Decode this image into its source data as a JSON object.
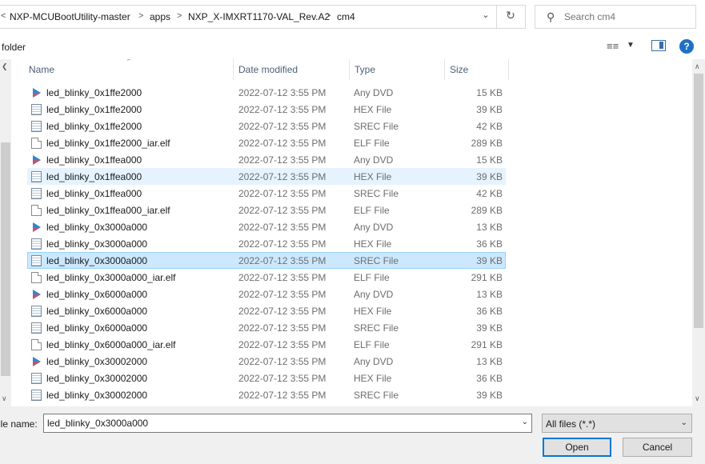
{
  "address_bar": {
    "breadcrumbs": [
      "NXP-MCUBootUtility-master",
      "apps",
      "NXP_X-IMXRT1170-VAL_Rev.A2",
      "cm4"
    ],
    "leading_chevron": "<",
    "separator_glyph": ">",
    "dropdown_icon": "chevron-down-icon",
    "refresh_icon": "refresh-icon"
  },
  "search": {
    "placeholder": "Search cm4",
    "icon": "search-icon"
  },
  "toolbar": {
    "new_folder_label": "folder",
    "views_icon": "view-options-icon",
    "preview_pane_icon": "preview-pane-icon",
    "help_label": "?"
  },
  "columns": {
    "name": "Name",
    "date": "Date modified",
    "type": "Type",
    "size": "Size"
  },
  "files": [
    {
      "name": "led_blinky_0x1ffe2000",
      "date": "2022-07-12 3:55 PM",
      "type": "Any DVD",
      "size": "15 KB",
      "icon": "dvd-file-icon",
      "state": "normal"
    },
    {
      "name": "led_blinky_0x1ffe2000",
      "date": "2022-07-12 3:55 PM",
      "type": "HEX File",
      "size": "39 KB",
      "icon": "text-file-icon",
      "state": "normal"
    },
    {
      "name": "led_blinky_0x1ffe2000",
      "date": "2022-07-12 3:55 PM",
      "type": "SREC File",
      "size": "42 KB",
      "icon": "text-file-icon",
      "state": "normal"
    },
    {
      "name": "led_blinky_0x1ffe2000_iar.elf",
      "date": "2022-07-12 3:55 PM",
      "type": "ELF File",
      "size": "289 KB",
      "icon": "blank-file-icon",
      "state": "normal"
    },
    {
      "name": "led_blinky_0x1ffea000",
      "date": "2022-07-12 3:55 PM",
      "type": "Any DVD",
      "size": "15 KB",
      "icon": "dvd-file-icon",
      "state": "normal"
    },
    {
      "name": "led_blinky_0x1ffea000",
      "date": "2022-07-12 3:55 PM",
      "type": "HEX File",
      "size": "39 KB",
      "icon": "text-file-icon",
      "state": "hover"
    },
    {
      "name": "led_blinky_0x1ffea000",
      "date": "2022-07-12 3:55 PM",
      "type": "SREC File",
      "size": "42 KB",
      "icon": "text-file-icon",
      "state": "normal"
    },
    {
      "name": "led_blinky_0x1ffea000_iar.elf",
      "date": "2022-07-12 3:55 PM",
      "type": "ELF File",
      "size": "289 KB",
      "icon": "blank-file-icon",
      "state": "normal"
    },
    {
      "name": "led_blinky_0x3000a000",
      "date": "2022-07-12 3:55 PM",
      "type": "Any DVD",
      "size": "13 KB",
      "icon": "dvd-file-icon",
      "state": "normal"
    },
    {
      "name": "led_blinky_0x3000a000",
      "date": "2022-07-12 3:55 PM",
      "type": "HEX File",
      "size": "36 KB",
      "icon": "text-file-icon",
      "state": "normal"
    },
    {
      "name": "led_blinky_0x3000a000",
      "date": "2022-07-12 3:55 PM",
      "type": "SREC File",
      "size": "39 KB",
      "icon": "text-file-icon",
      "state": "selected"
    },
    {
      "name": "led_blinky_0x3000a000_iar.elf",
      "date": "2022-07-12 3:55 PM",
      "type": "ELF File",
      "size": "291 KB",
      "icon": "blank-file-icon",
      "state": "normal"
    },
    {
      "name": "led_blinky_0x6000a000",
      "date": "2022-07-12 3:55 PM",
      "type": "Any DVD",
      "size": "13 KB",
      "icon": "dvd-file-icon",
      "state": "normal"
    },
    {
      "name": "led_blinky_0x6000a000",
      "date": "2022-07-12 3:55 PM",
      "type": "HEX File",
      "size": "36 KB",
      "icon": "text-file-icon",
      "state": "normal"
    },
    {
      "name": "led_blinky_0x6000a000",
      "date": "2022-07-12 3:55 PM",
      "type": "SREC File",
      "size": "39 KB",
      "icon": "text-file-icon",
      "state": "normal"
    },
    {
      "name": "led_blinky_0x6000a000_iar.elf",
      "date": "2022-07-12 3:55 PM",
      "type": "ELF File",
      "size": "291 KB",
      "icon": "blank-file-icon",
      "state": "normal"
    },
    {
      "name": "led_blinky_0x30002000",
      "date": "2022-07-12 3:55 PM",
      "type": "Any DVD",
      "size": "13 KB",
      "icon": "dvd-file-icon",
      "state": "normal"
    },
    {
      "name": "led_blinky_0x30002000",
      "date": "2022-07-12 3:55 PM",
      "type": "HEX File",
      "size": "36 KB",
      "icon": "text-file-icon",
      "state": "normal"
    },
    {
      "name": "led_blinky_0x30002000",
      "date": "2022-07-12 3:55 PM",
      "type": "SREC File",
      "size": "39 KB",
      "icon": "text-file-icon",
      "state": "normal"
    }
  ],
  "file_name": {
    "label": "ile name:",
    "value": "led_blinky_0x3000a000"
  },
  "file_type_filter": {
    "selected": "All files (*.*)"
  },
  "buttons": {
    "open": "Open",
    "cancel": "Cancel"
  },
  "colors": {
    "accent": "#0078d7",
    "selection_bg": "#cce8ff",
    "selection_border": "#99d1ff",
    "hover_bg": "#e5f3ff",
    "header_text": "#4c607a"
  }
}
